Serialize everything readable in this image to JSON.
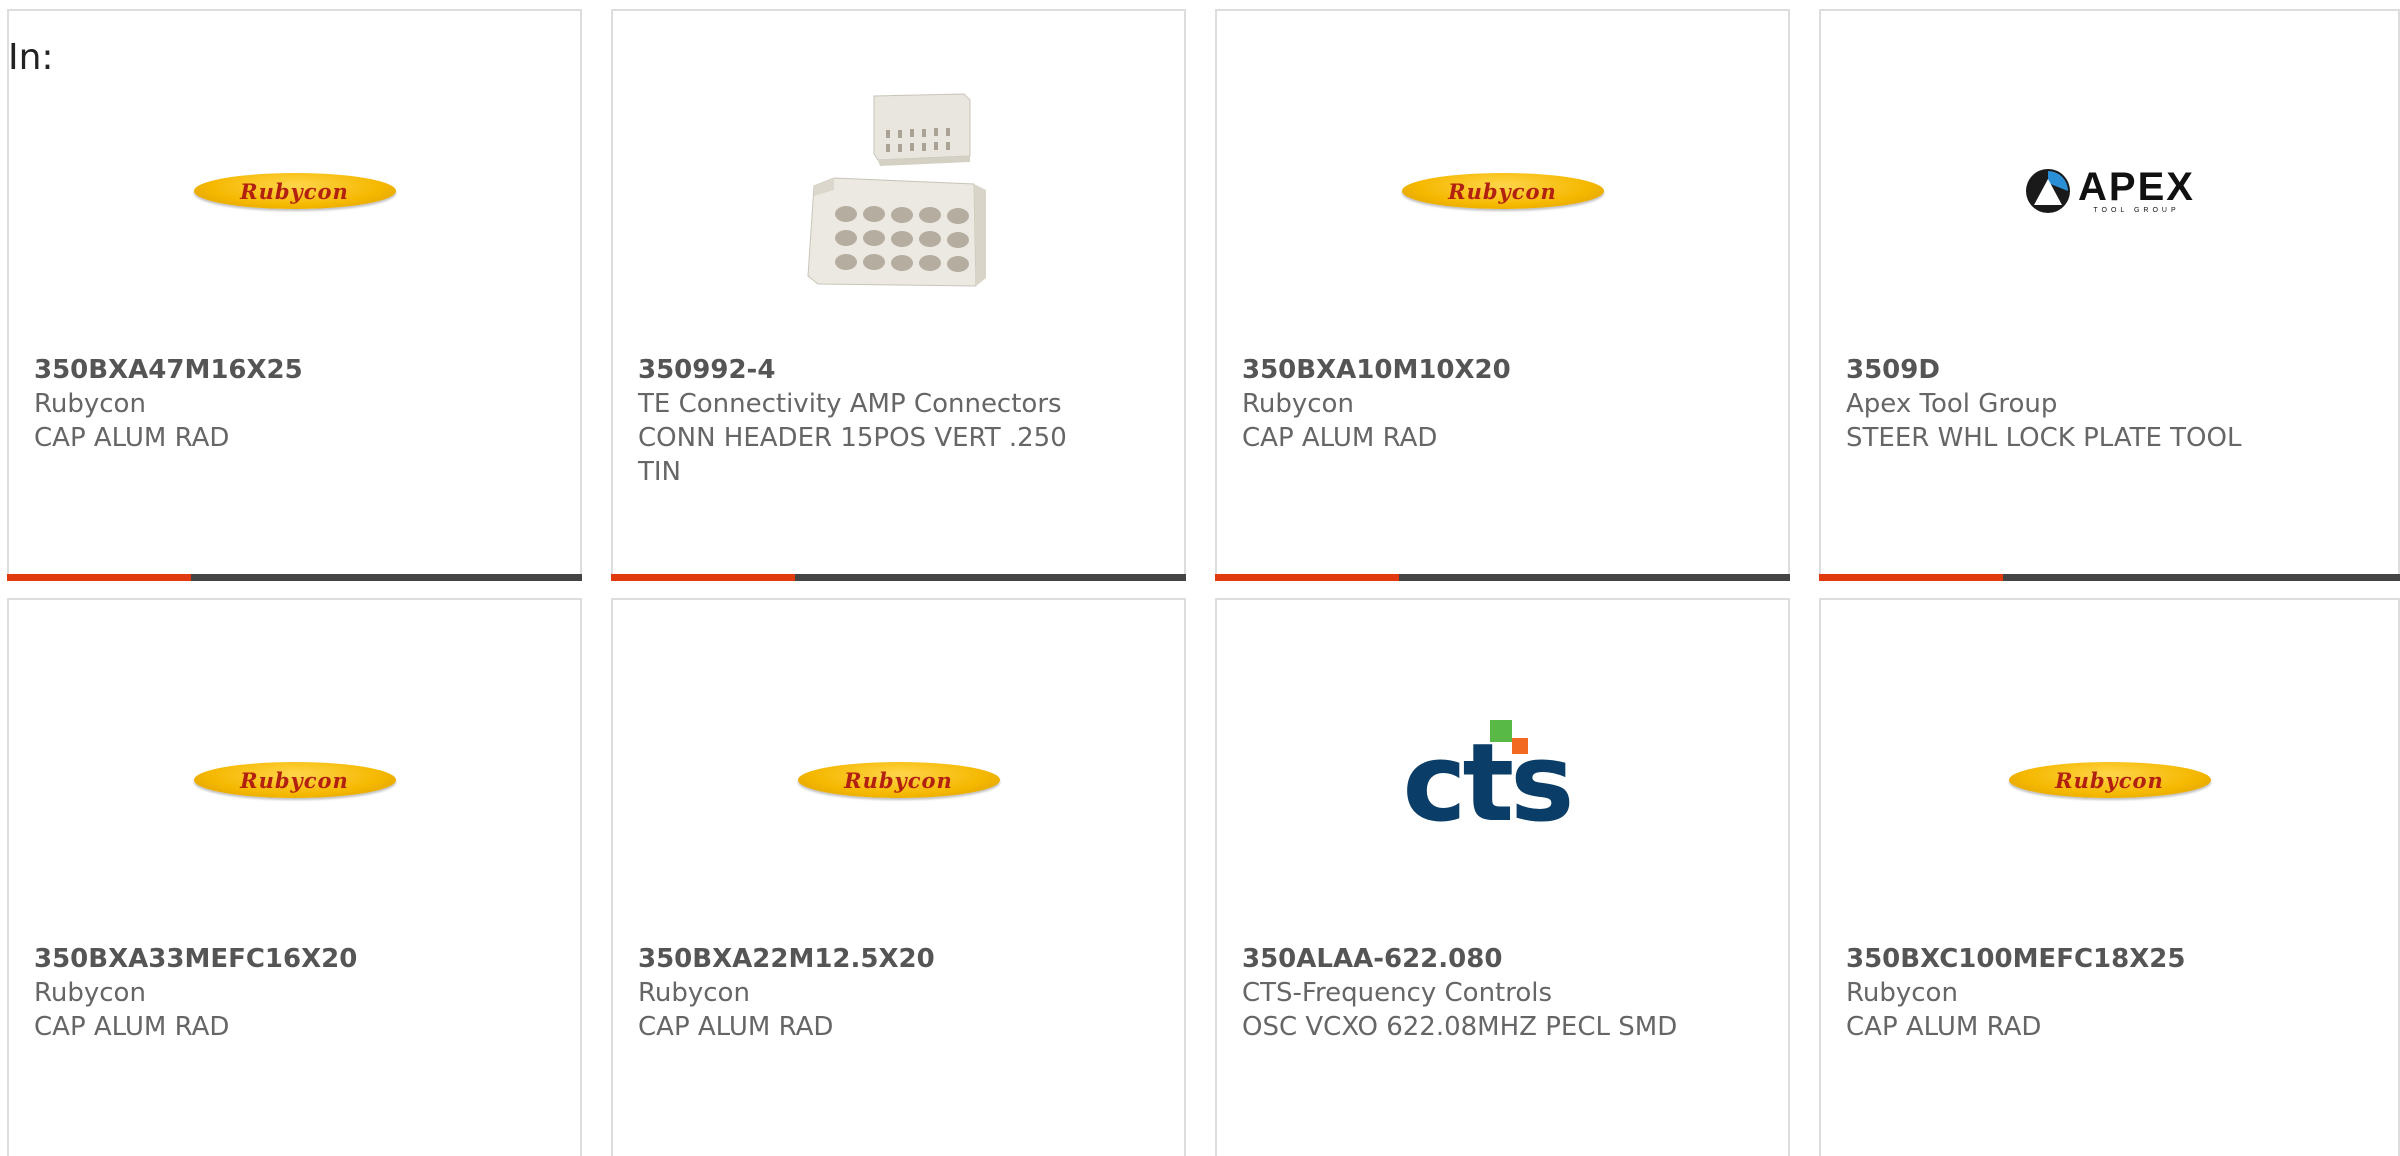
{
  "header": {
    "in_label": "In:"
  },
  "colors": {
    "accent": "#e03a0e",
    "bar": "#444444",
    "border": "#dddddd",
    "text": "#666666"
  },
  "products": [
    {
      "part_number": "350BXA47M16X25",
      "manufacturer": "Rubycon",
      "description": "CAP ALUM RAD",
      "image": "rubycon-logo",
      "logo_text": "Rubycon"
    },
    {
      "part_number": "350992-4",
      "manufacturer": "TE Connectivity AMP Connectors",
      "description": "CONN HEADER 15POS VERT .250 TIN",
      "image": "connector-photo"
    },
    {
      "part_number": "350BXA10M10X20",
      "manufacturer": "Rubycon",
      "description": "CAP ALUM RAD",
      "image": "rubycon-logo",
      "logo_text": "Rubycon"
    },
    {
      "part_number": "3509D",
      "manufacturer": "Apex Tool Group",
      "description": "STEER WHL LOCK PLATE TOOL",
      "image": "apex-logo",
      "logo_text": "APEX",
      "logo_subtext": "TOOL GROUP"
    },
    {
      "part_number": "350BXA33MEFC16X20",
      "manufacturer": "Rubycon",
      "description": "CAP ALUM RAD",
      "image": "rubycon-logo",
      "logo_text": "Rubycon"
    },
    {
      "part_number": "350BXA22M12.5X20",
      "manufacturer": "Rubycon",
      "description": "CAP ALUM RAD",
      "image": "rubycon-logo",
      "logo_text": "Rubycon"
    },
    {
      "part_number": "350ALAA-622.080",
      "manufacturer": "CTS-Frequency Controls",
      "description": "OSC VCXO 622.08MHZ PECL SMD",
      "image": "cts-logo",
      "logo_text": "cts"
    },
    {
      "part_number": "350BXC100MEFC18X25",
      "manufacturer": "Rubycon",
      "description": "CAP ALUM RAD",
      "image": "rubycon-logo",
      "logo_text": "Rubycon"
    }
  ]
}
